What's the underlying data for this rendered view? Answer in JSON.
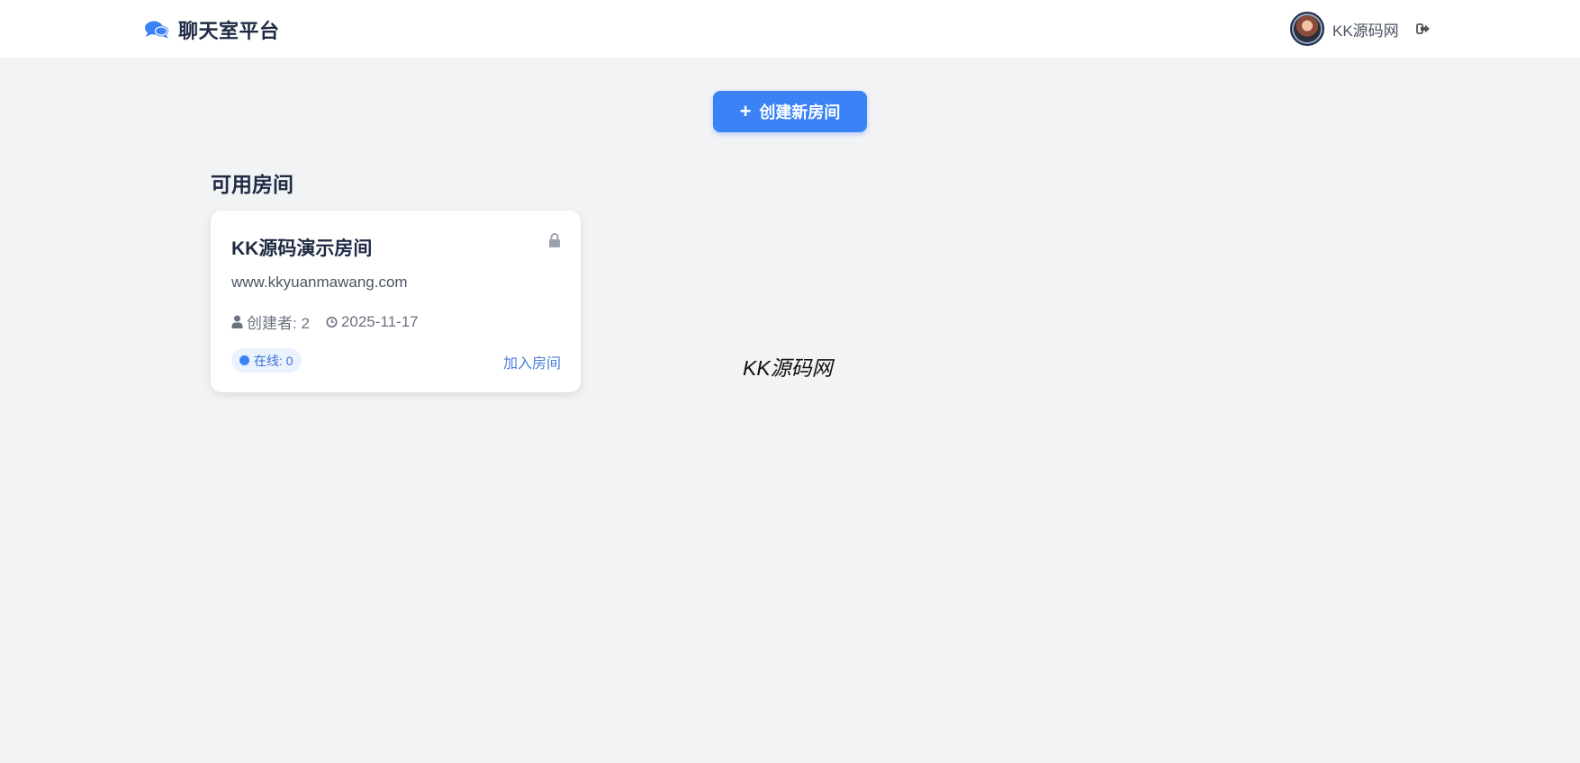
{
  "header": {
    "app_title": "聊天室平台",
    "brand_icon": "comments-icon",
    "username": "KK源码网",
    "logout_icon": "sign-out-icon"
  },
  "actions": {
    "create_room_label": "创建新房间",
    "create_room_icon": "plus-icon"
  },
  "rooms_section": {
    "title": "可用房间",
    "rooms": [
      {
        "name": "KK源码演示房间",
        "description": "www.kkyuanmawang.com",
        "locked": true,
        "creator_label": "创建者: 2",
        "created_date": "2025-11-17",
        "online_label": "在线: 0",
        "join_label": "加入房间"
      }
    ]
  },
  "watermark": "KK源码网",
  "colors": {
    "accent": "#3b82f6",
    "background": "#f2f3f5",
    "heading": "#1f2a44"
  }
}
